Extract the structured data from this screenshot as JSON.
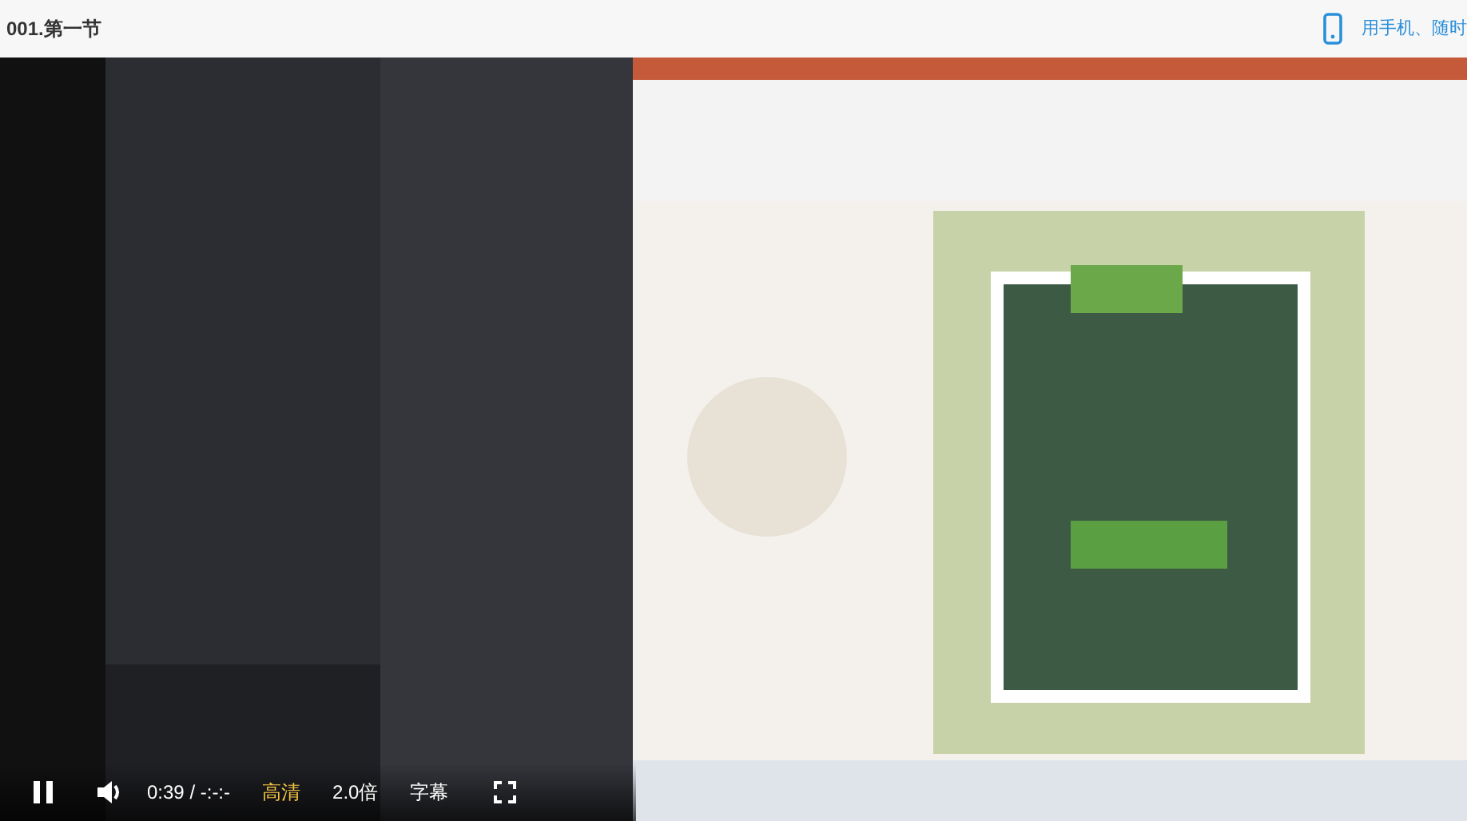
{
  "header": {
    "title": "001.第一节",
    "mobile_link": "用手机、随时"
  },
  "video": {
    "kind": "picture",
    "playing": true
  },
  "controls": {
    "time": "0:39 / -:-:-",
    "buttons": [
      {
        "label": "高清",
        "selected": true
      },
      {
        "label": "2.0倍",
        "selected": false
      },
      {
        "label": "字幕",
        "selected": false
      }
    ]
  }
}
